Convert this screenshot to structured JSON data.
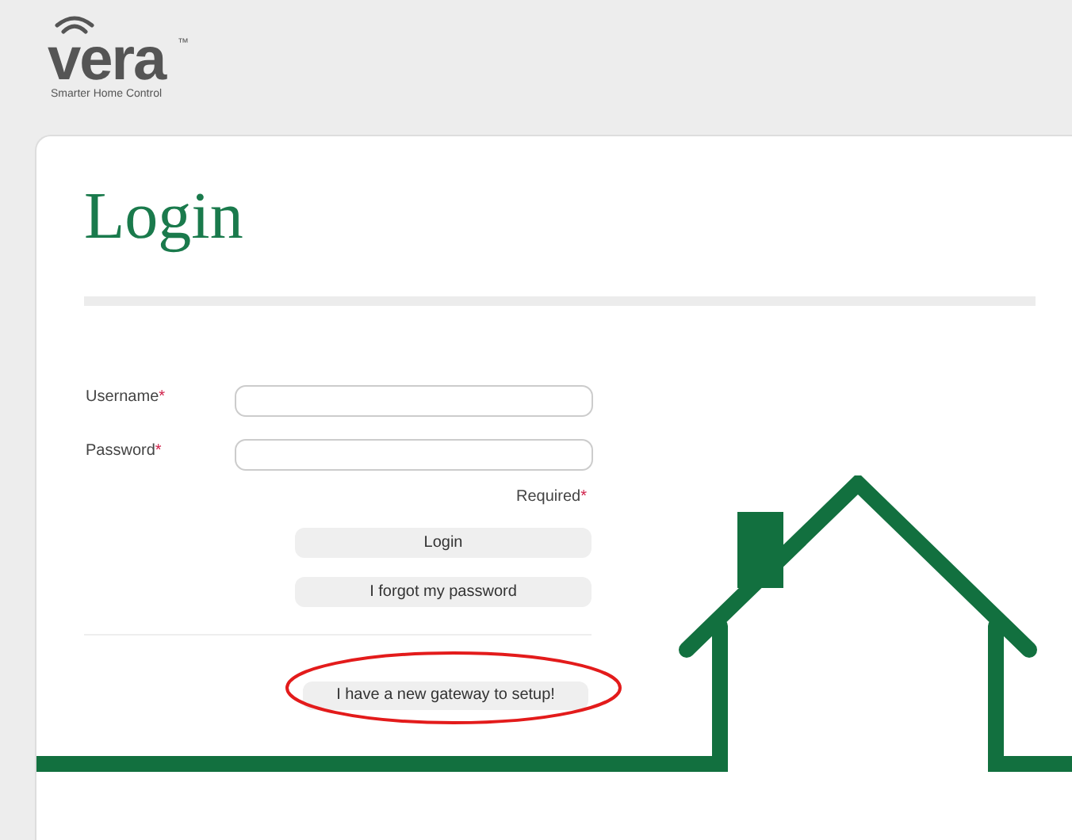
{
  "logo": {
    "wordmark": "vera",
    "trademark": "™",
    "tagline": "Smarter Home Control"
  },
  "title": "Login",
  "fields": [
    {
      "label": "Username",
      "mark": "*"
    },
    {
      "label": "Password",
      "mark": "*"
    }
  ],
  "required_note": {
    "text": "Required",
    "mark": "*"
  },
  "buttons": [
    "Login",
    "I forgot my password"
  ],
  "setup_button": {
    "label": "I have a new gateway to setup!",
    "highlighted": true
  }
}
